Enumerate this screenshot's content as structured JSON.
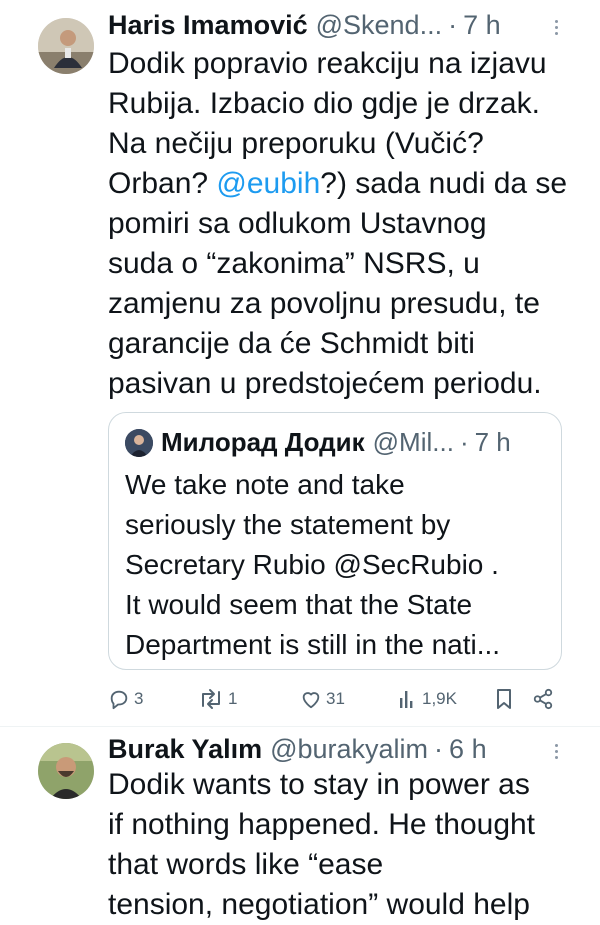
{
  "tweet1": {
    "name": "Haris Imamović",
    "handle": "@Skend...",
    "dot": "·",
    "time": "7 h",
    "text_before_mention": "Dodik popravio reakciju na izjavu\nRubija. Izbacio dio gdje je drzak.\nNa nečiju preporuku (Vučić?\nOrban? ",
    "mention": "@eubih",
    "text_after_mention": "?) sada nudi da se\npomiri sa odlukom Ustavnog\nsuda o “zakonima” NSRS, u\nzamjenu za povoljnu presudu, te\ngarancije da će Schmidt biti\npasivan u predstojećem periodu.",
    "quote": {
      "name": "Милорад Додик",
      "handle": "@Mil...",
      "dot": "·",
      "time": "7 h",
      "text": "We take note and take\nseriously the statement by\nSecretary Rubio @SecRubio .\nIt would seem that the State\nDepartment is still in the nati..."
    },
    "actions": {
      "replies": "3",
      "reposts": "1",
      "likes": "31",
      "views": "1,9K"
    }
  },
  "tweet2": {
    "name": "Burak Yalım",
    "handle": "@burakyalim",
    "dot": "·",
    "time": "6 h",
    "text": "Dodik wants to stay in power as\nif nothing happened. He thought\nthat words like “ease\ntension, negotiation” would help"
  },
  "icons": {
    "reply": "reply-icon",
    "repost": "repost-icon",
    "like": "heart-icon",
    "views": "views-icon",
    "bookmark": "bookmark-icon",
    "share": "share-icon",
    "more": "more-dots-icon"
  },
  "colors": {
    "text": "#0f1419",
    "secondary": "#536471",
    "link": "#1d9bf0",
    "border": "#cfd9de"
  }
}
